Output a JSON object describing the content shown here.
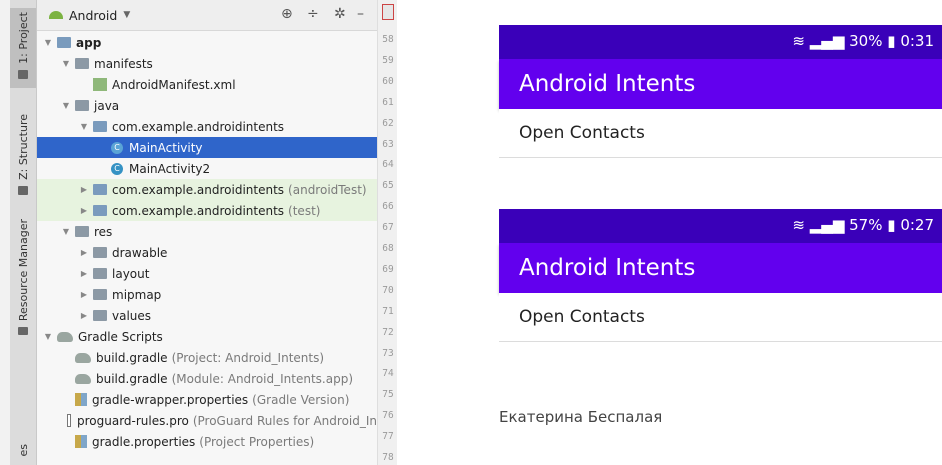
{
  "ide": {
    "sidebar_tabs": [
      "1: Project",
      "Z: Structure",
      "Resource Manager",
      "es"
    ],
    "toolbar": {
      "view_label": "Android"
    },
    "tree": [
      {
        "label": "app",
        "extra": "",
        "level": 0,
        "icon": "module",
        "arrow": "down",
        "bold": true
      },
      {
        "label": "manifests",
        "extra": "",
        "level": 1,
        "icon": "folder",
        "arrow": "down"
      },
      {
        "label": "AndroidManifest.xml",
        "extra": "",
        "level": 2,
        "icon": "xml",
        "arrow": ""
      },
      {
        "label": "java",
        "extra": "",
        "level": 1,
        "icon": "folder",
        "arrow": "down"
      },
      {
        "label": "com.example.androidintents",
        "extra": "",
        "level": 2,
        "icon": "package",
        "arrow": "down"
      },
      {
        "label": "MainActivity",
        "extra": "",
        "level": 3,
        "icon": "class",
        "arrow": "",
        "selected": true
      },
      {
        "label": "MainActivity2",
        "extra": "",
        "level": 3,
        "icon": "class",
        "arrow": ""
      },
      {
        "label": "com.example.androidintents",
        "extra": "(androidTest)",
        "level": 2,
        "icon": "package",
        "arrow": "right",
        "test": true
      },
      {
        "label": "com.example.androidintents",
        "extra": "(test)",
        "level": 2,
        "icon": "package",
        "arrow": "right",
        "test": true
      },
      {
        "label": "res",
        "extra": "",
        "level": 1,
        "icon": "folder",
        "arrow": "down"
      },
      {
        "label": "drawable",
        "extra": "",
        "level": 2,
        "icon": "folder",
        "arrow": "right"
      },
      {
        "label": "layout",
        "extra": "",
        "level": 2,
        "icon": "folder",
        "arrow": "right"
      },
      {
        "label": "mipmap",
        "extra": "",
        "level": 2,
        "icon": "folder",
        "arrow": "right"
      },
      {
        "label": "values",
        "extra": "",
        "level": 2,
        "icon": "folder",
        "arrow": "right"
      },
      {
        "label": "Gradle Scripts",
        "extra": "",
        "level": 0,
        "icon": "gradle",
        "arrow": "down"
      },
      {
        "label": "build.gradle",
        "extra": "(Project: Android_Intents)",
        "level": 1,
        "icon": "gradle",
        "arrow": "",
        "bold": true
      },
      {
        "label": "build.gradle",
        "extra": "(Module: Android_Intents.app)",
        "level": 1,
        "icon": "gradle",
        "arrow": "",
        "bold": true
      },
      {
        "label": "gradle-wrapper.properties",
        "extra": "(Gradle Version)",
        "level": 1,
        "icon": "properties",
        "arrow": "",
        "bold": true
      },
      {
        "label": "proguard-rules.pro",
        "extra": "(ProGuard Rules for Android_In",
        "level": 1,
        "icon": "doc",
        "arrow": "",
        "bold": true
      },
      {
        "label": "gradle.properties",
        "extra": "(Project Properties)",
        "level": 1,
        "icon": "properties",
        "arrow": "",
        "bold": true
      }
    ],
    "line_numbers": [
      "58",
      "59",
      "60",
      "61",
      "62",
      "63",
      "64",
      "65",
      "66",
      "67",
      "68",
      "69",
      "70",
      "71",
      "72",
      "73",
      "74",
      "75",
      "76",
      "77",
      "78"
    ]
  },
  "screens": [
    {
      "status": "&#x1F6DC; 30% 0:31",
      "status_text": "30%",
      "time": "0:31",
      "title": "Android Intents",
      "item": "Open Contacts"
    },
    {
      "status_text": "57%",
      "time": "0:27",
      "title": "Android Intents",
      "item": "Open Contacts"
    }
  ],
  "author": "Екатерина Беспалая",
  "colors": {
    "status_bar": "#3a00b9",
    "app_bar": "#6200ee",
    "selection": "#2f65ca"
  }
}
